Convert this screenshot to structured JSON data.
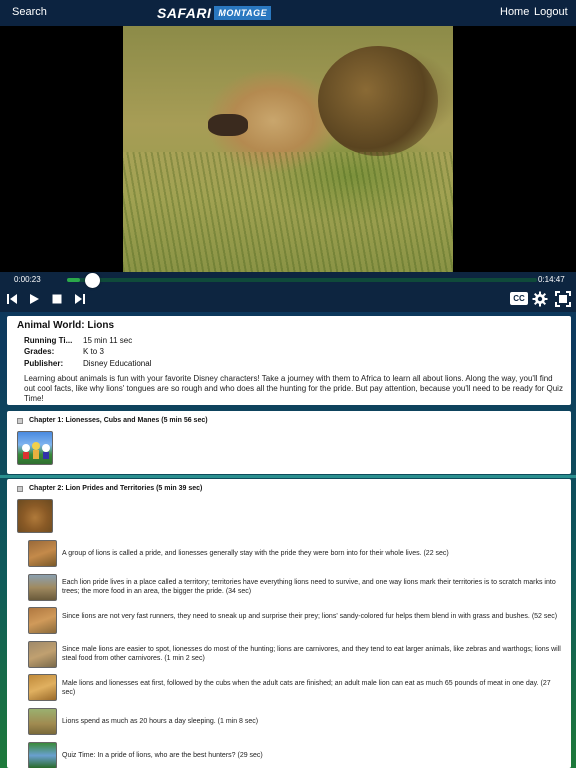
{
  "topbar": {
    "search_label": "Search",
    "logo_main": "SAFARI",
    "logo_sub": "MONTAGE",
    "home_label": "Home",
    "logout_label": "Logout"
  },
  "player": {
    "current_time": "0:00:23",
    "total_time": "0:14:47",
    "progress": 0.027,
    "cc_label": "CC",
    "icons": [
      "previous-icon",
      "play-icon",
      "stop-icon",
      "next-icon",
      "gear-icon",
      "fullscreen-icon"
    ]
  },
  "info": {
    "title": "Animal World: Lions",
    "running_time_label": "Running Ti...",
    "running_time": "15 min 11 sec",
    "grades_label": "Grades:",
    "grades": "K to 3",
    "publisher_label": "Publisher:",
    "publisher": "Disney Educational",
    "description": "Learning about animals is fun with your favorite Disney characters! Take a journey with them to Africa to learn all about lions. Along the way, you'll find out cool facts, like why lions' tongues are so rough and who does all the hunting for the pride. But pay attention, because you'll need to be ready for Quiz Time!"
  },
  "chapters": [
    {
      "title": "Chapter 1:  Lionesses, Cubs and Manes (5 min 56 sec)",
      "expanded": false
    },
    {
      "title": "Chapter 2:  Lion Prides and Territories (5 min 39 sec)",
      "expanded": true,
      "segments": [
        "A group of lions is called a pride, and lionesses generally stay with the pride they were born into for their whole lives. (22 sec)",
        "Each lion pride lives in a place called a territory; territories have everything lions need to survive, and one way lions mark their territories is to scratch marks into trees; the more food in an area, the bigger the pride. (34 sec)",
        "Since lions are not very fast runners, they need to sneak up and surprise their prey; lions' sandy-colored fur helps them blend in with grass and bushes. (52 sec)",
        "Since male lions are easier to spot, lionesses do most of the hunting; lions are carnivores, and they tend to eat larger animals, like zebras and warthogs; lions will steal food from other carnivores. (1 min 2 sec)",
        "Male lions and lionesses eat first, followed by the cubs when the adult cats are finished; an adult male lion can eat as much 65 pounds of meat in one day. (27 sec)",
        "Lions spend as much as 20 hours a day sleeping. (1 min 8 sec)",
        "Quiz Time: In a pride of lions, who are the best hunters? (29 sec)"
      ]
    }
  ]
}
